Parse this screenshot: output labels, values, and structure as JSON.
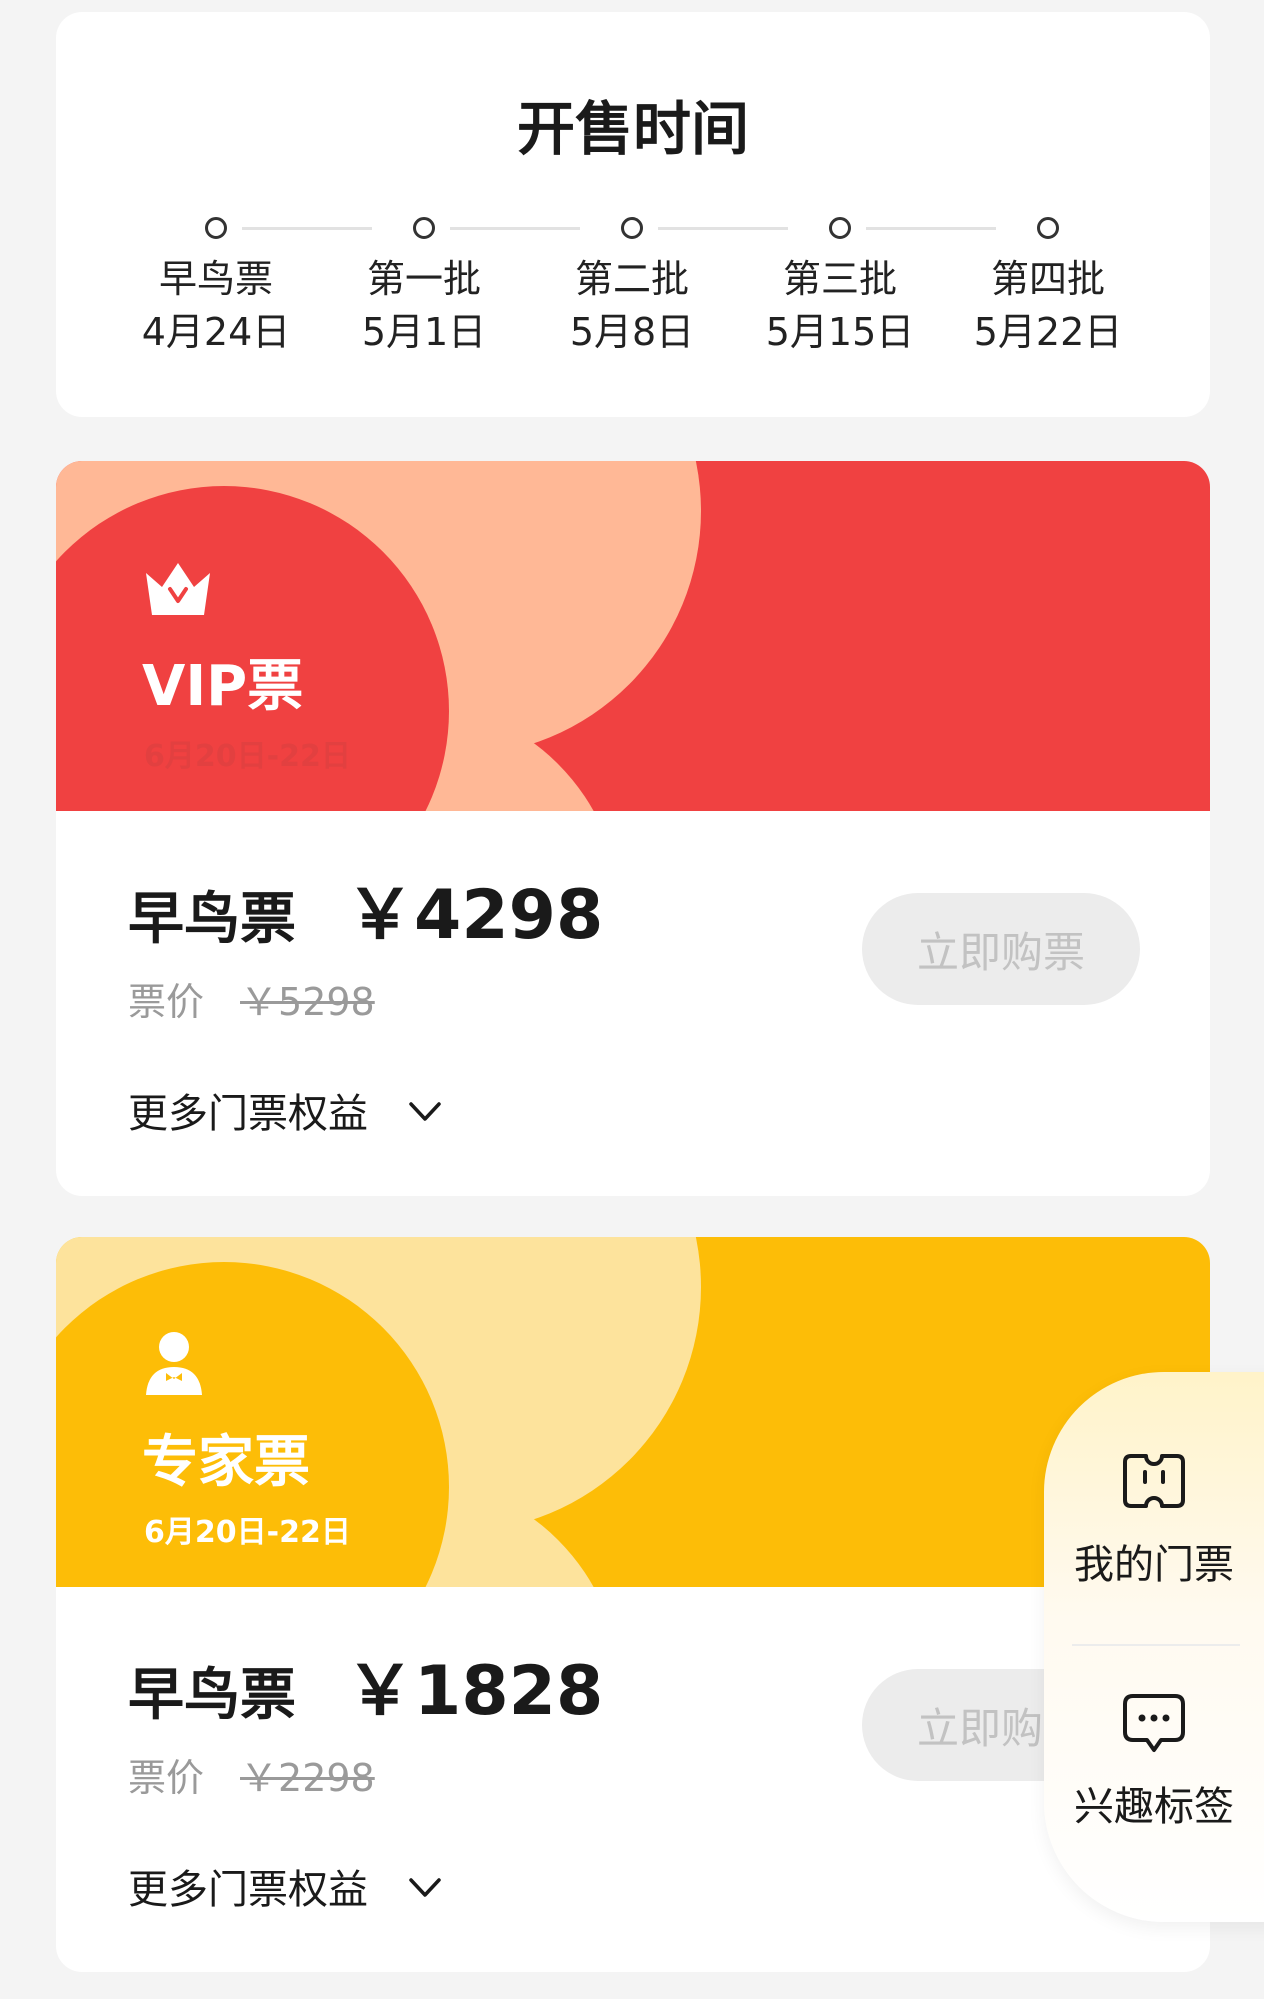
{
  "schedule": {
    "title": "开售时间",
    "steps": [
      {
        "name": "早鸟票",
        "date": "4月24日"
      },
      {
        "name": "第一批",
        "date": "5月1日"
      },
      {
        "name": "第二批",
        "date": "5月8日"
      },
      {
        "name": "第三批",
        "date": "5月15日"
      },
      {
        "name": "第四批",
        "date": "5月22日"
      }
    ]
  },
  "tickets": [
    {
      "name": "VIP票",
      "dates": "6月20日-22日",
      "icon": "crown-icon",
      "colors": {
        "base": "#f04141",
        "petal": "#ffb896",
        "dates_text": "#e24040"
      },
      "tier_label": "早鸟票",
      "price": "￥4298",
      "original_label": "票价",
      "original_price": "￥5298",
      "benefits_label": "更多门票权益",
      "buy_label": "立即购票"
    },
    {
      "name": "专家票",
      "dates": "6月20日-22日",
      "icon": "expert-person-icon",
      "colors": {
        "base": "#fdbd07",
        "petal": "#fde39c",
        "dates_text": "#ffffff"
      },
      "tier_label": "早鸟票",
      "price": "￥1828",
      "original_label": "票价",
      "original_price": "￥2298",
      "benefits_label": "更多门票权益",
      "buy_label": "立即购票"
    }
  ],
  "floating_panel": {
    "my_tickets_label": "我的门票",
    "interest_tags_label": "兴趣标签"
  }
}
